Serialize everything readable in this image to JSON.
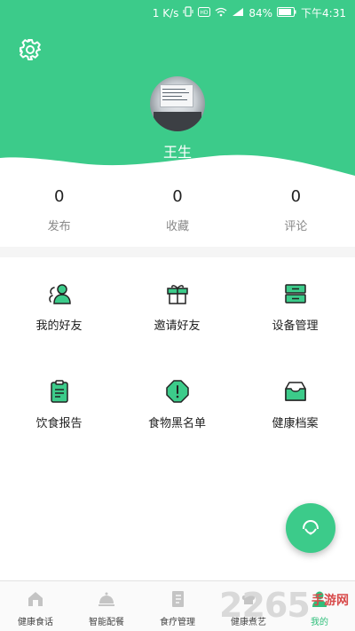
{
  "status_bar": {
    "speed": "1 K/s",
    "battery": "84%",
    "time": "下午4:31",
    "network_badge": "HD"
  },
  "colors": {
    "accent": "#3ccb8a",
    "header": "#3ccb8a",
    "active_tab": "#2fbf7b"
  },
  "profile": {
    "name": "王生"
  },
  "stats": [
    {
      "value": "0",
      "label": "发布"
    },
    {
      "value": "0",
      "label": "收藏"
    },
    {
      "value": "0",
      "label": "评论"
    }
  ],
  "menu": [
    {
      "label": "我的好友",
      "icon": "friends-icon"
    },
    {
      "label": "邀请好友",
      "icon": "gift-icon"
    },
    {
      "label": "设备管理",
      "icon": "device-icon"
    },
    {
      "label": "饮食报告",
      "icon": "report-icon"
    },
    {
      "label": "食物黑名单",
      "icon": "blacklist-icon"
    },
    {
      "label": "健康档案",
      "icon": "archive-icon"
    }
  ],
  "tabs": [
    {
      "label": "健康食话",
      "icon": "home-icon"
    },
    {
      "label": "智能配餐",
      "icon": "dish-icon"
    },
    {
      "label": "食疗管理",
      "icon": "notebook-icon"
    },
    {
      "label": "健康煮艺",
      "icon": "chef-icon"
    },
    {
      "label": "我的",
      "icon": "user-icon",
      "active": true
    }
  ],
  "watermark": {
    "number": "2265",
    "text": "手游网"
  }
}
